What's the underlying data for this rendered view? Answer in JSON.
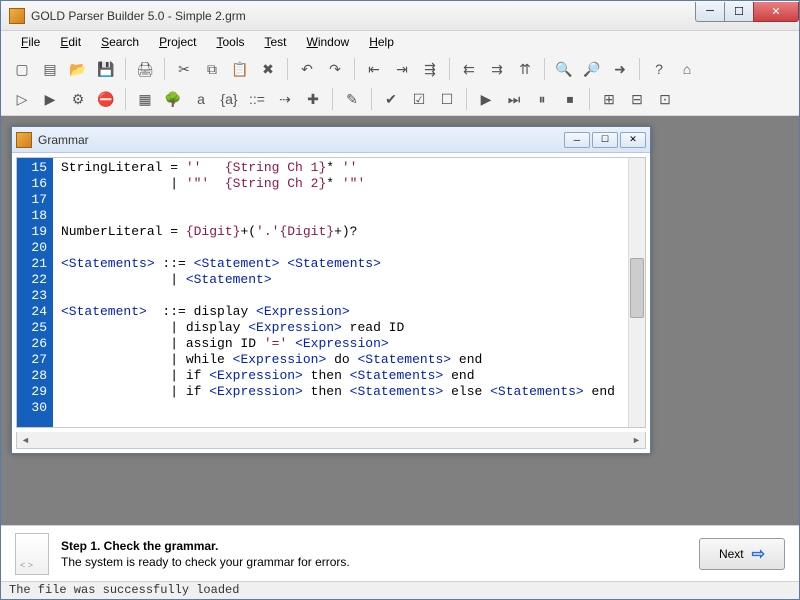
{
  "titlebar": {
    "title": "GOLD Parser Builder 5.0 - Simple 2.grm"
  },
  "menu": {
    "items": [
      {
        "label": "File",
        "ul": "F"
      },
      {
        "label": "Edit",
        "ul": "E"
      },
      {
        "label": "Search",
        "ul": "S"
      },
      {
        "label": "Project",
        "ul": "P"
      },
      {
        "label": "Tools",
        "ul": "T"
      },
      {
        "label": "Test",
        "ul": "T"
      },
      {
        "label": "Window",
        "ul": "W"
      },
      {
        "label": "Help",
        "ul": "H"
      }
    ]
  },
  "toolbar_icons": [
    "new",
    "new-template",
    "open",
    "save",
    "sep",
    "print",
    "sep",
    "cut",
    "copy",
    "paste",
    "delete",
    "sep",
    "undo",
    "redo",
    "sep",
    "outdent",
    "indent",
    "increase-indent",
    "sep",
    "step-left",
    "step-right",
    "step-up",
    "sep",
    "find",
    "find-replace",
    "goto",
    "sep",
    "help",
    "home",
    "break",
    "run",
    "run-all",
    "compile",
    "stop",
    "sep",
    "table-group",
    "tree",
    "text-a",
    "braces",
    "colons",
    "flow",
    "add-node",
    "sep",
    "edit-pencil",
    "sep",
    "check",
    "check-doc",
    "uncheck",
    "sep",
    "play",
    "fast-forward",
    "pause",
    "stop-square",
    "sep",
    "tree1",
    "tree2",
    "tree3"
  ],
  "icon_glyphs": {
    "new": "▢",
    "new-template": "▤",
    "open": "📂",
    "save": "💾",
    "print": "🖨",
    "cut": "✂",
    "copy": "⧉",
    "paste": "📋",
    "delete": "✖",
    "undo": "↶",
    "redo": "↷",
    "outdent": "⇤",
    "indent": "⇥",
    "increase-indent": "⇶",
    "step-left": "⇇",
    "step-right": "⇉",
    "step-up": "⇈",
    "find": "🔍",
    "find-replace": "🔎",
    "goto": "➜",
    "help": "?",
    "home": "⌂",
    "run": "▷",
    "run-all": "▶",
    "compile": "⚙",
    "stop": "⛔",
    "table-group": "▦",
    "tree": "🌳",
    "text-a": "a",
    "braces": "{a}",
    "colons": "::=",
    "flow": "⇢",
    "add-node": "✚",
    "edit-pencil": "✎",
    "check": "✔",
    "check-doc": "☑",
    "uncheck": "☐",
    "play": "▶",
    "fast-forward": "⏭",
    "pause": "⏸",
    "stop-square": "⏹",
    "tree1": "⊞",
    "tree2": "⊟",
    "tree3": "⊡"
  },
  "inner_window": {
    "title": "Grammar"
  },
  "editor": {
    "first_line": 15,
    "lines": [
      [
        {
          "t": "StringLiteral = "
        },
        {
          "t": "''",
          "c": "lit"
        },
        {
          "t": "   "
        },
        {
          "t": "{String Ch 1}",
          "c": "lit"
        },
        {
          "t": "* "
        },
        {
          "t": "''",
          "c": "lit"
        }
      ],
      [
        {
          "t": "              | "
        },
        {
          "t": "'\"'",
          "c": "lit"
        },
        {
          "t": "  "
        },
        {
          "t": "{String Ch 2}",
          "c": "lit"
        },
        {
          "t": "* "
        },
        {
          "t": "'\"'",
          "c": "lit"
        }
      ],
      [],
      [],
      [
        {
          "t": "NumberLiteral = "
        },
        {
          "t": "{Digit}",
          "c": "lit"
        },
        {
          "t": "+("
        },
        {
          "t": "'.'",
          "c": "lit"
        },
        {
          "t": "{Digit}",
          "c": "lit"
        },
        {
          "t": "+)?"
        }
      ],
      [],
      [
        {
          "t": "<Statements>",
          "c": "rule"
        },
        {
          "t": " ::= "
        },
        {
          "t": "<Statement>",
          "c": "rule"
        },
        {
          "t": " "
        },
        {
          "t": "<Statements>",
          "c": "rule"
        }
      ],
      [
        {
          "t": "              | "
        },
        {
          "t": "<Statement>",
          "c": "rule"
        }
      ],
      [],
      [
        {
          "t": "<Statement>",
          "c": "rule"
        },
        {
          "t": "  ::= display "
        },
        {
          "t": "<Expression>",
          "c": "rule"
        }
      ],
      [
        {
          "t": "              | display "
        },
        {
          "t": "<Expression>",
          "c": "rule"
        },
        {
          "t": " read ID"
        }
      ],
      [
        {
          "t": "              | assign ID "
        },
        {
          "t": "'='",
          "c": "lit"
        },
        {
          "t": " "
        },
        {
          "t": "<Expression>",
          "c": "rule"
        }
      ],
      [
        {
          "t": "              | while "
        },
        {
          "t": "<Expression>",
          "c": "rule"
        },
        {
          "t": " do "
        },
        {
          "t": "<Statements>",
          "c": "rule"
        },
        {
          "t": " end"
        }
      ],
      [
        {
          "t": "              | if "
        },
        {
          "t": "<Expression>",
          "c": "rule"
        },
        {
          "t": " then "
        },
        {
          "t": "<Statements>",
          "c": "rule"
        },
        {
          "t": " end"
        }
      ],
      [
        {
          "t": "              | if "
        },
        {
          "t": "<Expression>",
          "c": "rule"
        },
        {
          "t": " then "
        },
        {
          "t": "<Statements>",
          "c": "rule"
        },
        {
          "t": " else "
        },
        {
          "t": "<Statements>",
          "c": "rule"
        },
        {
          "t": " end"
        }
      ],
      []
    ]
  },
  "wizard": {
    "title": "Step 1. Check the grammar.",
    "desc": "The system is ready to check your grammar for errors.",
    "next_label": "Next"
  },
  "statusbar": {
    "text": "The file was successfully loaded"
  }
}
